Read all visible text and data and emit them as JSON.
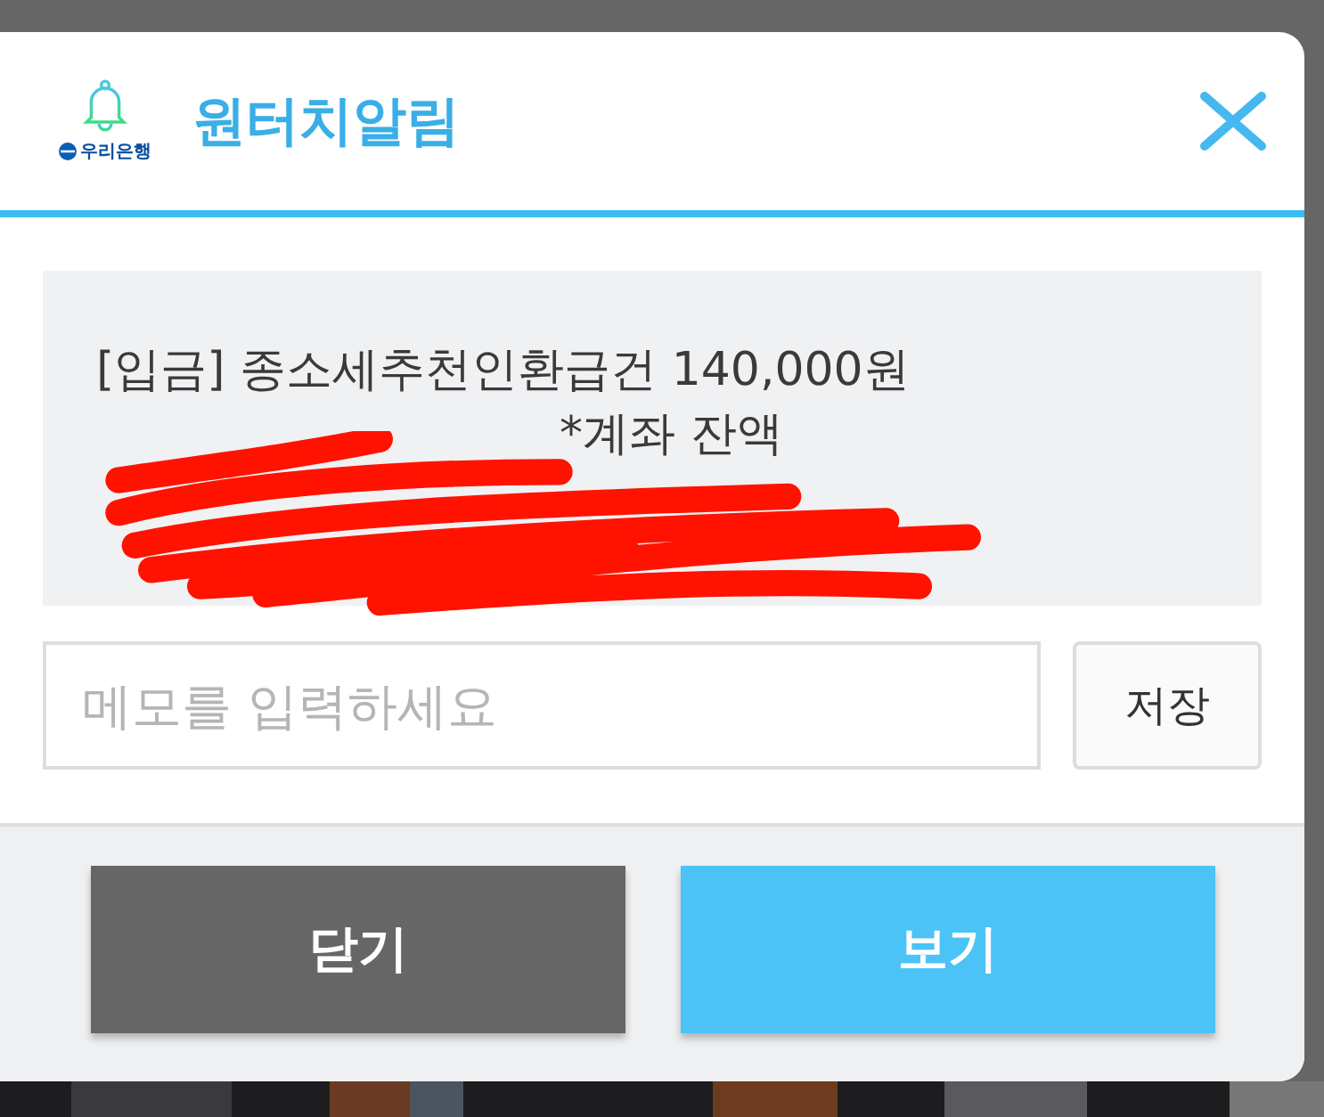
{
  "dialog": {
    "title": "원터치알림",
    "bank_logo_text": "우리은행",
    "message": {
      "line_1": "[입금] 종소세추천인환급건  140,000원",
      "line_2": "*계좌 잔액",
      "redacted": true
    },
    "memo": {
      "placeholder": "메모를 입력하세요"
    },
    "save_button": "저장",
    "buttons": [
      {
        "label": "닫기",
        "kind": "secondary"
      },
      {
        "label": "보기",
        "kind": "primary"
      }
    ]
  }
}
